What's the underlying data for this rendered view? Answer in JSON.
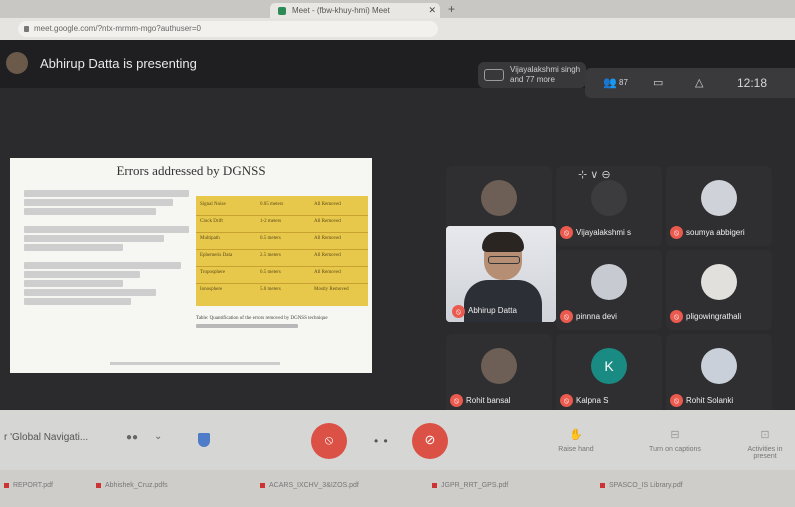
{
  "browser": {
    "tab_title": "Meet - (fbw-khuy-hmi) Meet",
    "url": "meet.google.com/?ntx-mrmm-mgo?authuser=0",
    "new_tab_label": "+"
  },
  "meet": {
    "presenting_title": "Abhirup Datta is presenting",
    "participants_chip": "Vijayalakshmi singh and 77 more",
    "time": "12:18",
    "people_count": "87",
    "meeting_name": "r 'Global Navigati...",
    "caption_button": "Raise hand",
    "captions_label": "Turn on captions",
    "activities_label": "Activities in present"
  },
  "slide": {
    "title": "Errors addressed by DGNSS",
    "table": [
      [
        "Signal Noise",
        "0.05 meters",
        "All Removed"
      ],
      [
        "Clock Drift",
        "1-2 meters",
        "All Removed"
      ],
      [
        "Multipath",
        "0.5 meters",
        "All Removed"
      ],
      [
        "Ephemeris Data",
        "2.5 meters",
        "All Removed"
      ],
      [
        "Troposphere",
        "0.5 meters",
        "All Removed"
      ],
      [
        "Ionosphere",
        "5.0 meters",
        "Mostly Removed"
      ]
    ],
    "caption": "Table: Quantification of the errors removed by DGNSS technique"
  },
  "participants": [
    {
      "name": "Abhirup Datta",
      "avatar_color": "#6d5f55"
    },
    {
      "name": "Vijayalakshmi s",
      "avatar_color": "#3c3c3e"
    },
    {
      "name": "soumya abbigeri",
      "avatar_color": "#cfd2d9"
    },
    {
      "name": "Abhirup Datta",
      "avatar_color": "#b68e74"
    },
    {
      "name": "pinnna devi",
      "avatar_color": "#c7cbd1"
    },
    {
      "name": "pligowingrathali",
      "avatar_color": "#e2e0dc"
    },
    {
      "name": "Rohit bansal",
      "avatar_color": "#6d5f55"
    },
    {
      "name": "Kalpna S",
      "avatar_color": "#1a8b83",
      "initial": "K"
    },
    {
      "name": "Rohit Solanki",
      "avatar_color": "#c9d0da"
    }
  ],
  "taskbar": [
    "REPORT.pdf",
    "Abhishek_Cruz.pdfs",
    "ACARS_IXCHV_3&IZOS.pdf",
    "JGPR_RRT_GPS.pdf",
    "SPASCO_IS Library.pdf"
  ]
}
